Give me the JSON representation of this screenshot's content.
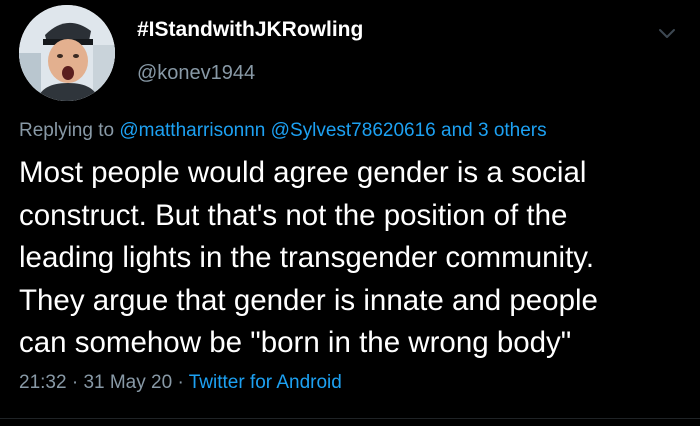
{
  "user": {
    "display_name": "#IStandwithJKRowling",
    "handle": "@konev1944",
    "avatar_icon": "avatar-portrait"
  },
  "reply": {
    "prefix": "Replying to",
    "mentions": [
      "@mattharrisonnn",
      "@Sylvest78620616"
    ],
    "others": "and 3 others"
  },
  "tweet": {
    "lines": [
      "Most people would agree gender is a social",
      "construct. But that's not the position of the",
      "leading lights in the transgender community.",
      "They argue that gender is innate and people",
      "can somehow be \"born in the wrong body\""
    ]
  },
  "meta": {
    "time": "21:32",
    "date": "31 May 20",
    "separator": "·",
    "source": "Twitter for Android"
  },
  "colors": {
    "background": "#000000",
    "text": "#ffffff",
    "secondary": "#8899a6",
    "link": "#1da1f2"
  },
  "icons": {
    "more": "chevron-down-icon"
  }
}
